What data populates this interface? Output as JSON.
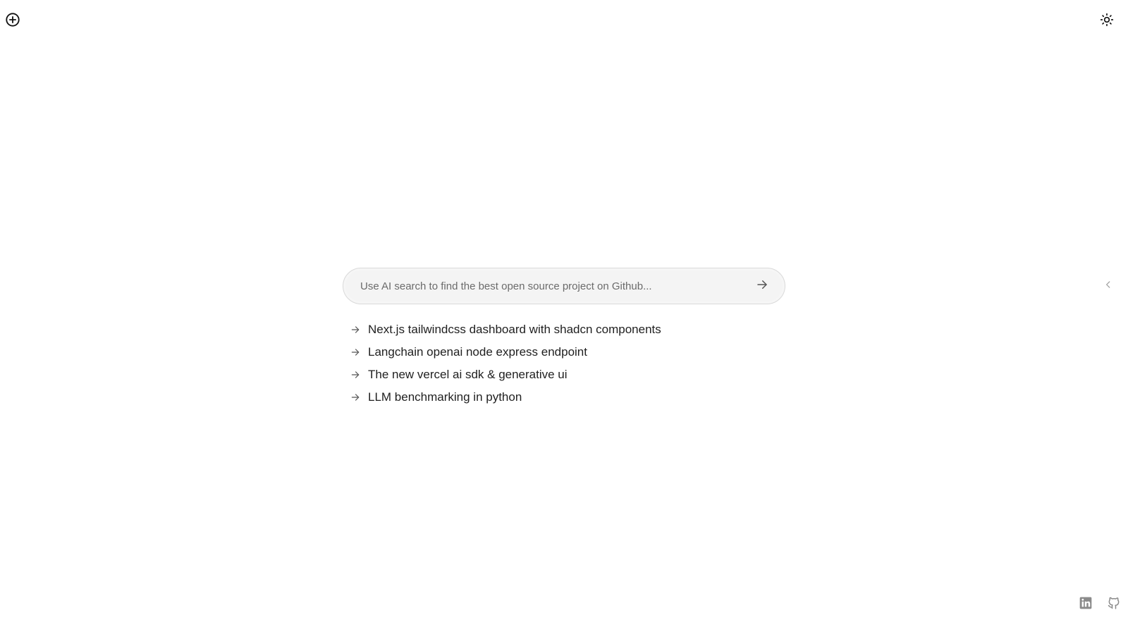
{
  "header": {
    "new_icon": "plus-circle-icon",
    "theme_icon": "sun-icon"
  },
  "search": {
    "placeholder": "Use AI search to find the best open source project on Github...",
    "value": "",
    "submit_icon": "arrow-right-icon"
  },
  "suggestions": [
    {
      "label": "Next.js tailwindcss dashboard with shadcn components",
      "icon": "arrow-right-icon"
    },
    {
      "label": "Langchain openai node express endpoint",
      "icon": "arrow-right-icon"
    },
    {
      "label": "The new vercel ai sdk & generative ui",
      "icon": "arrow-right-icon"
    },
    {
      "label": "LLM benchmarking in python",
      "icon": "arrow-right-icon"
    }
  ],
  "side": {
    "collapse_icon": "chevron-left-icon"
  },
  "footer": {
    "linkedin_icon": "linkedin-icon",
    "github_icon": "github-icon"
  },
  "colors": {
    "text": "#1f1f1f",
    "muted": "#6b6b6b",
    "input_bg": "#f4f4f4",
    "border": "#d9d9d9",
    "footer_icon": "#8a8a8a"
  }
}
